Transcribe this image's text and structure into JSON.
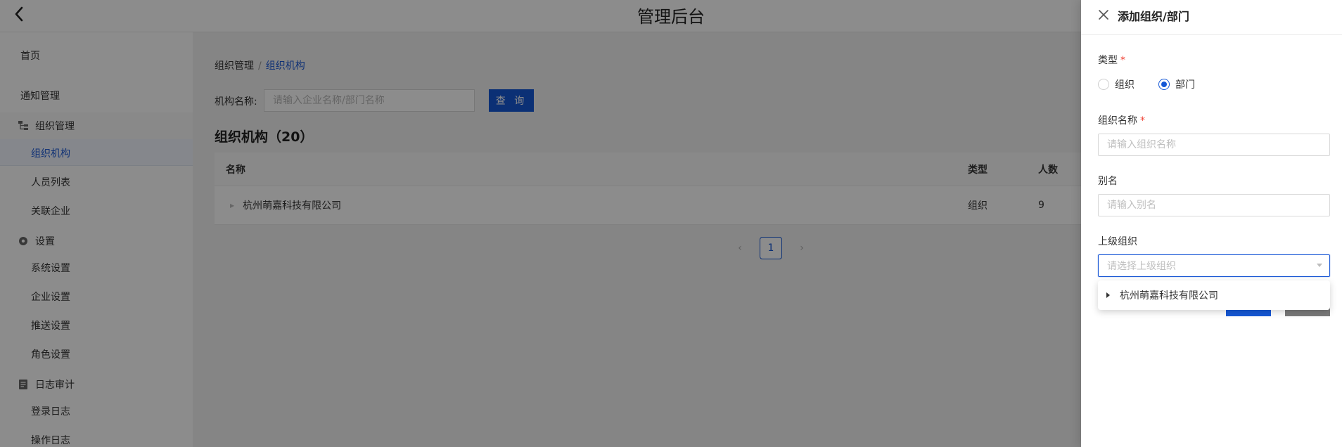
{
  "app": {
    "title": "管理后台"
  },
  "sidebar": {
    "home": "首页",
    "notice": "通知管理",
    "org_group": "组织管理",
    "org_items": [
      "组织机构",
      "人员列表",
      "关联企业"
    ],
    "settings_group": "设置",
    "settings_items": [
      "系统设置",
      "企业设置",
      "推送设置",
      "角色设置"
    ],
    "log_group": "日志审计",
    "log_items": [
      "登录日志",
      "操作日志"
    ]
  },
  "breadcrumb": {
    "parent": "组织管理",
    "sep": "/",
    "current": "组织机构"
  },
  "search": {
    "label": "机构名称:",
    "placeholder": "请输入企业名称/部门名称",
    "button": "查 询"
  },
  "list": {
    "title": "组织机构（20）",
    "columns": {
      "name": "名称",
      "type": "类型",
      "count": "人数"
    },
    "rows": [
      {
        "name": "杭州萌嘉科技有限公司",
        "type": "组织",
        "count": "9"
      }
    ]
  },
  "pagination": {
    "prev": "‹",
    "current": "1",
    "next": "›"
  },
  "drawer": {
    "title": "添加组织/部门",
    "type_label": "类型",
    "req_mark": "*",
    "type_options": [
      "组织",
      "部门"
    ],
    "type_selected": "部门",
    "name_label": "组织名称",
    "name_placeholder": "请输入组织名称",
    "alias_label": "别名",
    "alias_placeholder": "请输入别名",
    "parent_label": "上级组织",
    "parent_placeholder": "请选择上级组织",
    "parent_options": [
      "杭州萌嘉科技有限公司"
    ]
  }
}
